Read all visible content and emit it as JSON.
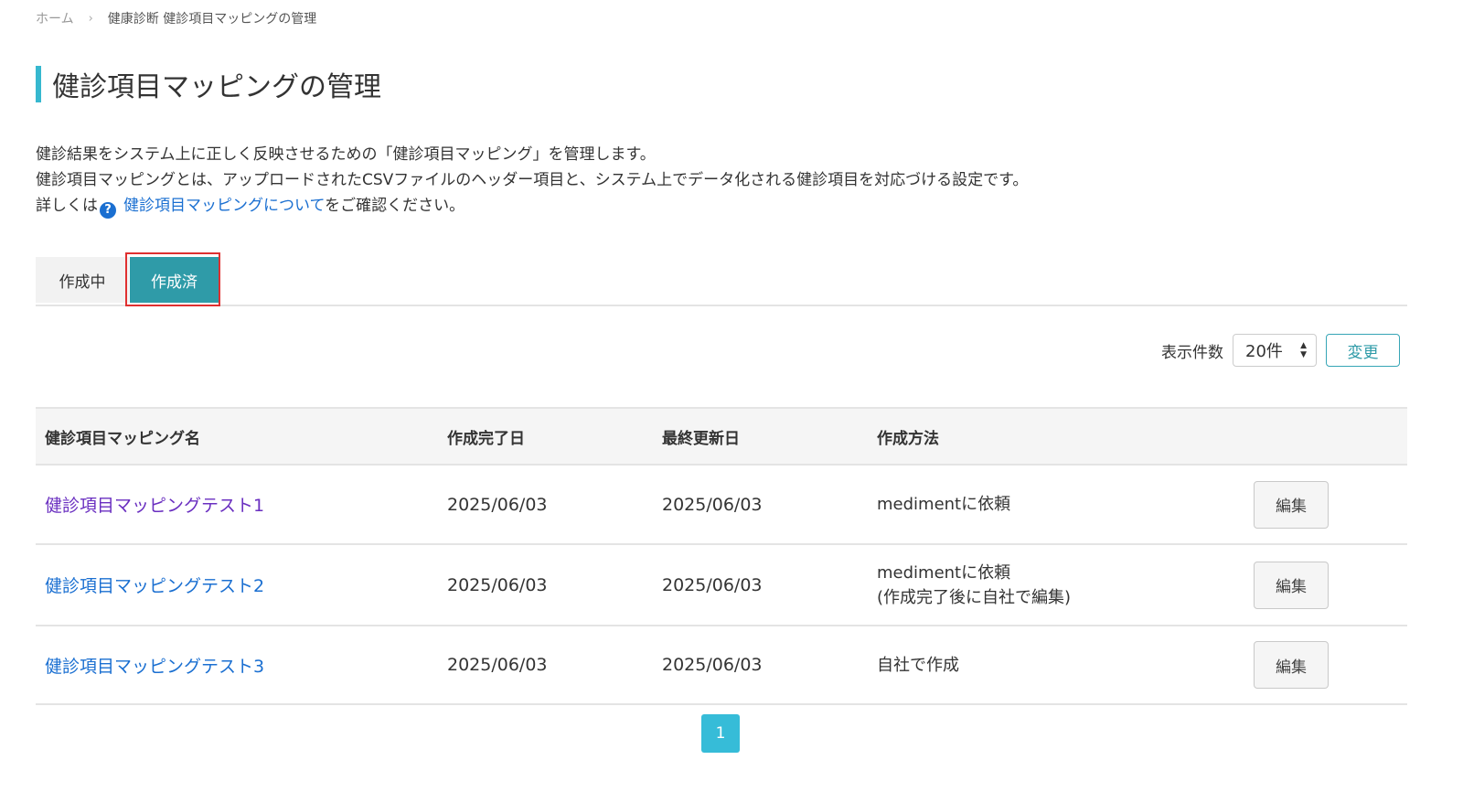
{
  "breadcrumb": {
    "home": "ホーム",
    "separator": "›",
    "current": "健康診断 健診項目マッピングの管理"
  },
  "page_title": "健診項目マッピングの管理",
  "description": {
    "line1": "健診結果をシステム上に正しく反映させるための「健診項目マッピング」を管理します。",
    "line2": "健診項目マッピングとは、アップロードされたCSVファイルのヘッダー項目と、システム上でデータ化される健診項目を対応づける設定です。",
    "line3_prefix": "詳しくは",
    "help_icon": "?",
    "link_text": "健診項目マッピングについて",
    "line3_suffix": "をご確認ください。"
  },
  "tabs": {
    "creating": "作成中",
    "completed": "作成済",
    "active": "completed"
  },
  "per_page": {
    "label": "表示件数",
    "value": "20件",
    "button": "変更"
  },
  "table": {
    "headers": [
      "健診項目マッピング名",
      "作成完了日",
      "最終更新日",
      "作成方法"
    ],
    "rows": [
      {
        "name": "健診項目マッピングテスト1",
        "completed": "2025/06/03",
        "updated": "2025/06/03",
        "method": [
          "medimentに依頼"
        ],
        "edit": "編集",
        "link_color": "#6a2fc0"
      },
      {
        "name": "健診項目マッピングテスト2",
        "completed": "2025/06/03",
        "updated": "2025/06/03",
        "method": [
          "medimentに依頼",
          "(作成完了後に自社で編集)"
        ],
        "edit": "編集",
        "link_color": "#1a6fd1"
      },
      {
        "name": "健診項目マッピングテスト3",
        "completed": "2025/06/03",
        "updated": "2025/06/03",
        "method": [
          "自社で作成"
        ],
        "edit": "編集",
        "link_color": "#1a6fd1"
      }
    ]
  },
  "pagination": {
    "current": "1"
  },
  "colors": {
    "accent": "#36b8cf",
    "tab_active": "#2f9ba8",
    "link": "#1a6fd1",
    "visited_link": "#6a2fc0",
    "highlight": "#e03030"
  }
}
